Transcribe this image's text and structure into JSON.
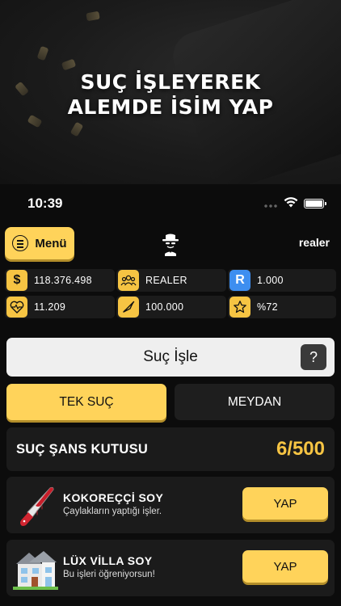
{
  "promo": {
    "headline_line1": "SUÇ İŞLEYEREK",
    "headline_line2": "ALEMDE İSİM YAP"
  },
  "status_bar": {
    "time": "10:39",
    "icons": [
      "wifi-icon",
      "battery-icon"
    ]
  },
  "app_bar": {
    "menu_label": "Menü",
    "menu_icon": "menu-lines-icon",
    "avatar_icon": "gangster-avatar-icon",
    "username": "realer"
  },
  "stats": [
    {
      "icon": "dollar-icon",
      "symbol": "$",
      "value": "118.376.498"
    },
    {
      "icon": "group-icon",
      "symbol": "",
      "value": "REALER"
    },
    {
      "icon": "r-coin-icon",
      "symbol": "R",
      "value": "1.000"
    },
    {
      "icon": "heart-pulse-icon",
      "symbol": "",
      "value": "11.209"
    },
    {
      "icon": "bullet-icon",
      "symbol": "",
      "value": "100.000"
    },
    {
      "icon": "star-icon",
      "symbol": "",
      "value": "%72"
    }
  ],
  "action": {
    "label": "Suç İşle",
    "help": "?"
  },
  "tabs": [
    {
      "label": "TEK SUÇ",
      "active": true
    },
    {
      "label": "MEYDAN",
      "active": false
    }
  ],
  "chance_box": {
    "label": "SUÇ ŞANS KUTUSU",
    "count": "6/500"
  },
  "crimes": [
    {
      "icon": "bloody-knife-icon",
      "title": "KOKOREÇÇİ SOY",
      "desc": "Çaylakların yaptığı işler.",
      "button": "YAP"
    },
    {
      "icon": "house-icon",
      "title": "LÜX VİLLA SOY",
      "desc": "Bu işleri öğreniyorsun!",
      "button": "YAP"
    }
  ],
  "colors": {
    "accent": "#ffd35a",
    "gold_text": "#f6c443",
    "card_bg": "#1b1b1b",
    "blue_badge": "#3d8ef0"
  }
}
